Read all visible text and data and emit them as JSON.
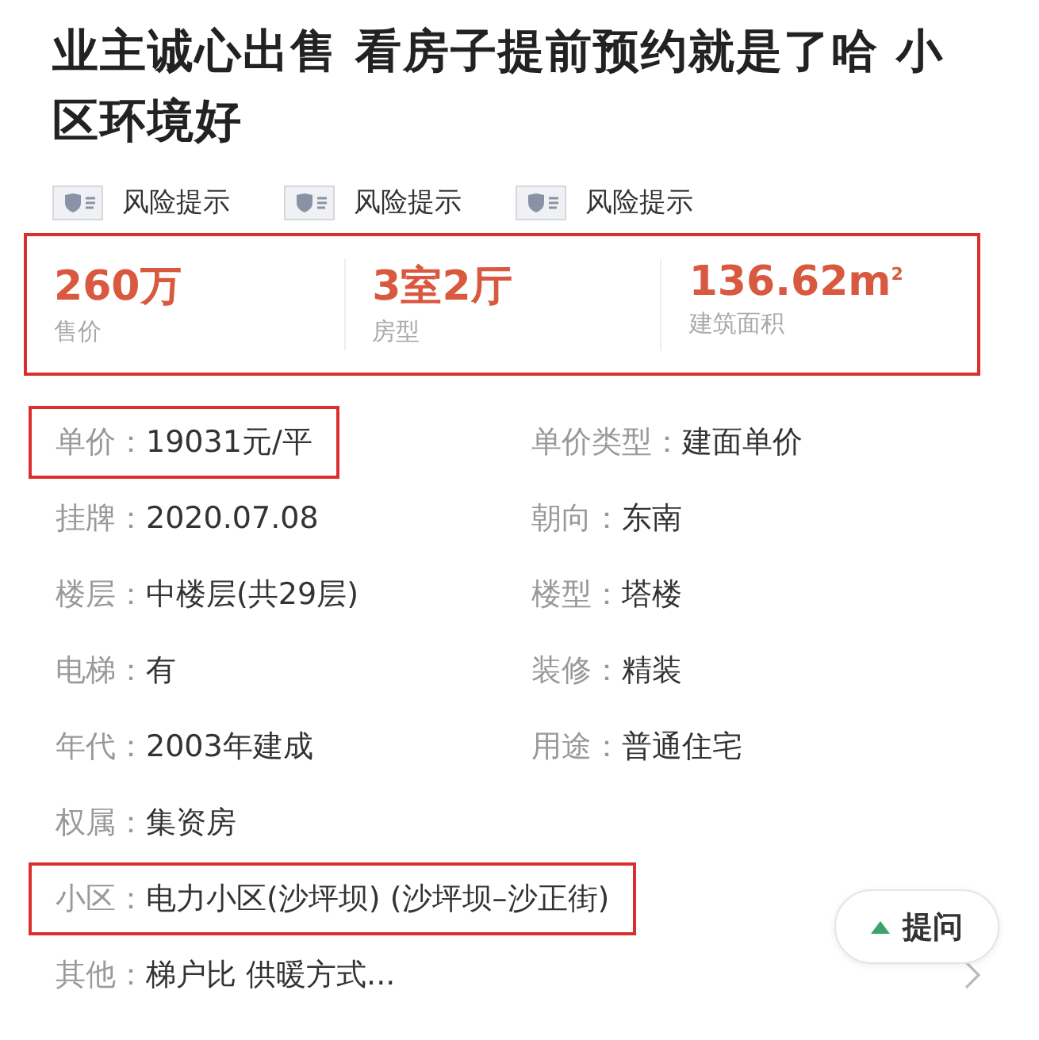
{
  "title": "业主诚心出售 看房子提前预约就是了哈 小区环境好",
  "risk_tags": [
    {
      "label": "风险提示"
    },
    {
      "label": "风险提示"
    },
    {
      "label": "风险提示"
    }
  ],
  "stats": {
    "highlighted": true,
    "items": [
      {
        "value": "260万",
        "label": "售价"
      },
      {
        "value": "3室2厅",
        "label": "房型"
      },
      {
        "value": "136.62m$^{2}$",
        "label": "建筑面积"
      }
    ]
  },
  "details": [
    {
      "items": [
        {
          "label": "单价：",
          "value": "19031元/平",
          "highlighted": true
        },
        {
          "label": "单价类型：",
          "value": "建面单价",
          "highlighted": false
        }
      ]
    },
    {
      "items": [
        {
          "label": "挂牌：",
          "value": "2020.07.08",
          "highlighted": false
        },
        {
          "label": "朝向：",
          "value": "东南",
          "highlighted": false
        }
      ]
    },
    {
      "items": [
        {
          "label": "楼层：",
          "value": "中楼层(共29层)",
          "highlighted": false
        },
        {
          "label": "楼型：",
          "value": "塔楼",
          "highlighted": false
        }
      ]
    },
    {
      "items": [
        {
          "label": "电梯：",
          "value": "有",
          "highlighted": false
        },
        {
          "label": "装修：",
          "value": "精装",
          "highlighted": false
        }
      ]
    },
    {
      "items": [
        {
          "label": "年代：",
          "value": "2003年建成",
          "highlighted": false
        },
        {
          "label": "用途：",
          "value": "普通住宅",
          "highlighted": false
        }
      ]
    },
    {
      "items": [
        {
          "label": "权属：",
          "value": "集资房",
          "highlighted": false
        }
      ]
    },
    {
      "kind": "wide",
      "items": [
        {
          "label": "小区：",
          "value": "电力小区(沙坪坝) (沙坪坝–沙正街)",
          "highlighted": true
        }
      ]
    },
    {
      "kind": "link",
      "items": [
        {
          "label": "其他：",
          "value": "梯户比 供暖方式...",
          "highlighted": false
        }
      ]
    }
  ],
  "ask_button": {
    "label": "提问"
  }
}
